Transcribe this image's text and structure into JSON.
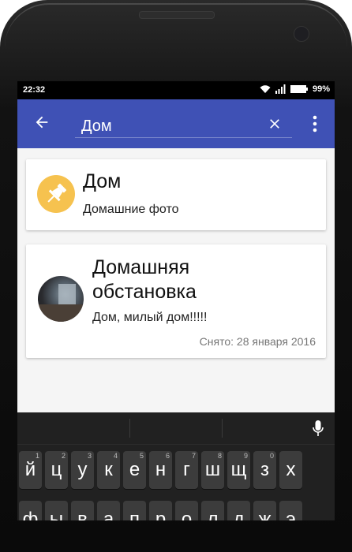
{
  "status": {
    "time": "22:32",
    "battery": "99%"
  },
  "appbar": {
    "query": "Дом"
  },
  "results": [
    {
      "title": "Дом",
      "subtitle": "Домашние фото"
    },
    {
      "title": "Домашняя обстановка",
      "subtitle": "Дом, милый дом!!!!!",
      "date": "Снято: 28 января 2016"
    }
  ],
  "keyboard": {
    "row1": [
      {
        "k": "й",
        "n": "1"
      },
      {
        "k": "ц",
        "n": "2"
      },
      {
        "k": "у",
        "n": "3"
      },
      {
        "k": "к",
        "n": "4"
      },
      {
        "k": "е",
        "n": "5"
      },
      {
        "k": "н",
        "n": "6"
      },
      {
        "k": "г",
        "n": "7"
      },
      {
        "k": "ш",
        "n": "8"
      },
      {
        "k": "щ",
        "n": "9"
      },
      {
        "k": "з",
        "n": "0"
      },
      {
        "k": "х",
        "n": ""
      }
    ],
    "row2": [
      {
        "k": "ф",
        "n": ""
      },
      {
        "k": "ы",
        "n": ""
      },
      {
        "k": "в",
        "n": ""
      },
      {
        "k": "а",
        "n": ""
      },
      {
        "k": "п",
        "n": ""
      },
      {
        "k": "р",
        "n": ""
      },
      {
        "k": "о",
        "n": ""
      },
      {
        "k": "л",
        "n": ""
      },
      {
        "k": "д",
        "n": ""
      },
      {
        "k": "ж",
        "n": ""
      },
      {
        "k": "э",
        "n": ""
      }
    ]
  },
  "colors": {
    "appbar": "#3f51b5",
    "pin_avatar": "#f6c24f",
    "keyboard": "#212121"
  }
}
